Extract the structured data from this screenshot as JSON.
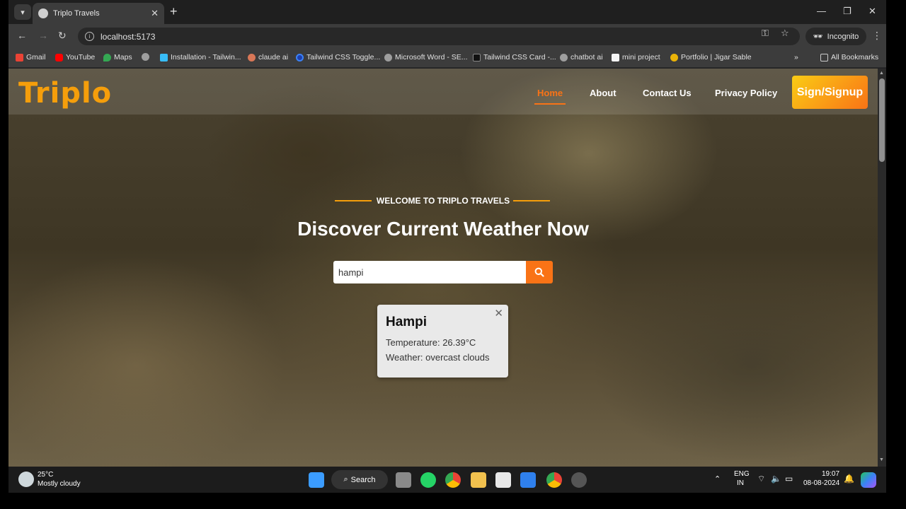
{
  "browser": {
    "tab_title": "Triplo Travels",
    "url": "localhost:5173",
    "incognito_label": "Incognito",
    "bookmarks": [
      "Gmail",
      "YouTube",
      "Maps",
      "",
      "Installation - Tailwin...",
      "claude ai",
      "Tailwind CSS Toggle...",
      "Microsoft Word - SE...",
      "Tailwind CSS Card -...",
      "chatbot ai",
      "mini project",
      "Portfolio | Jigar Sable"
    ],
    "all_bookmarks": "All Bookmarks"
  },
  "site": {
    "logo": "Triplo",
    "nav": [
      "Home",
      "About",
      "Contact Us",
      "Privacy Policy"
    ],
    "signin_label": "Sign/Signup",
    "welcome": "WELCOME TO TRIPLO TRAVELS",
    "headline": "Discover Current Weather Now",
    "search_value": "hampi",
    "card": {
      "city": "Hampi",
      "temperature": "Temperature: 26.39°C",
      "weather": "Weather: overcast clouds"
    }
  },
  "taskbar": {
    "weather_temp": "25°C",
    "weather_desc": "Mostly cloudy",
    "search_label": "Search",
    "lang1": "ENG",
    "lang2": "IN",
    "time": "19:07",
    "date": "08-08-2024"
  }
}
